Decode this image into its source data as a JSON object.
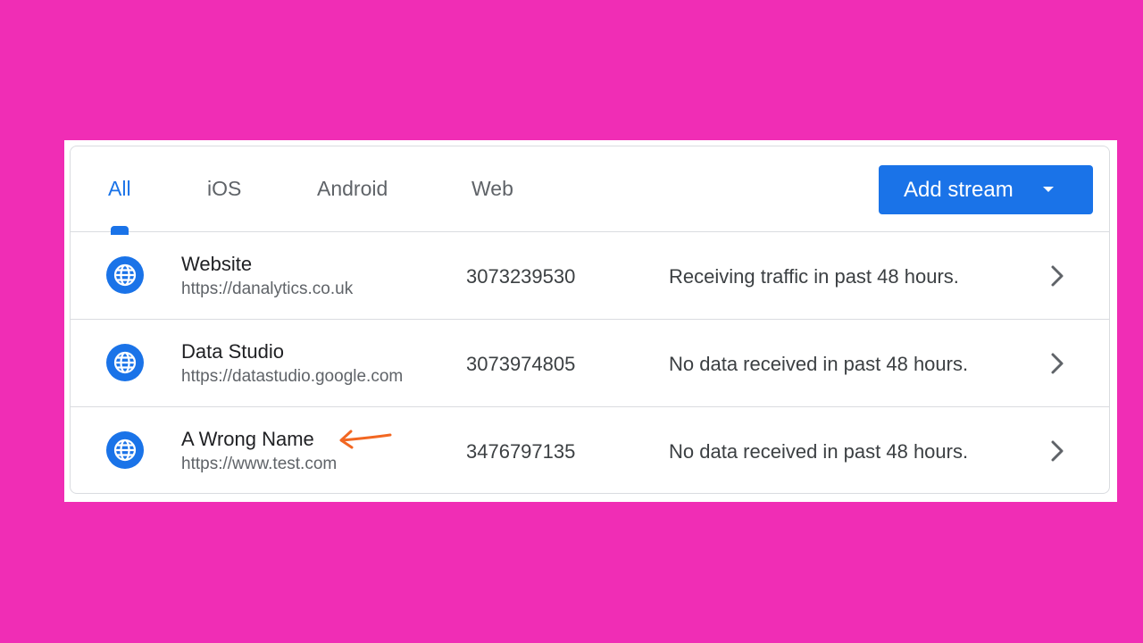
{
  "tabs": [
    {
      "label": "All",
      "active": true
    },
    {
      "label": "iOS",
      "active": false
    },
    {
      "label": "Android",
      "active": false
    },
    {
      "label": "Web",
      "active": false
    }
  ],
  "add_stream": {
    "label": "Add stream"
  },
  "streams": [
    {
      "name": "Website",
      "url": "https://danalytics.co.uk",
      "id": "3073239530",
      "status": "Receiving traffic in past 48 hours."
    },
    {
      "name": "Data Studio",
      "url": "https://datastudio.google.com",
      "id": "3073974805",
      "status": "No data received in past 48 hours."
    },
    {
      "name": "A Wrong Name",
      "url": "https://www.test.com",
      "id": "3476797135",
      "status": "No data received in past 48 hours."
    }
  ],
  "colors": {
    "background": "#f02db5",
    "accent": "#1a73e8",
    "annotation": "#f26722"
  },
  "icons": {
    "stream": "globe-icon",
    "row_action": "chevron-right-icon",
    "dropdown": "caret-down-icon",
    "annotation": "hand-drawn-arrow-icon"
  }
}
